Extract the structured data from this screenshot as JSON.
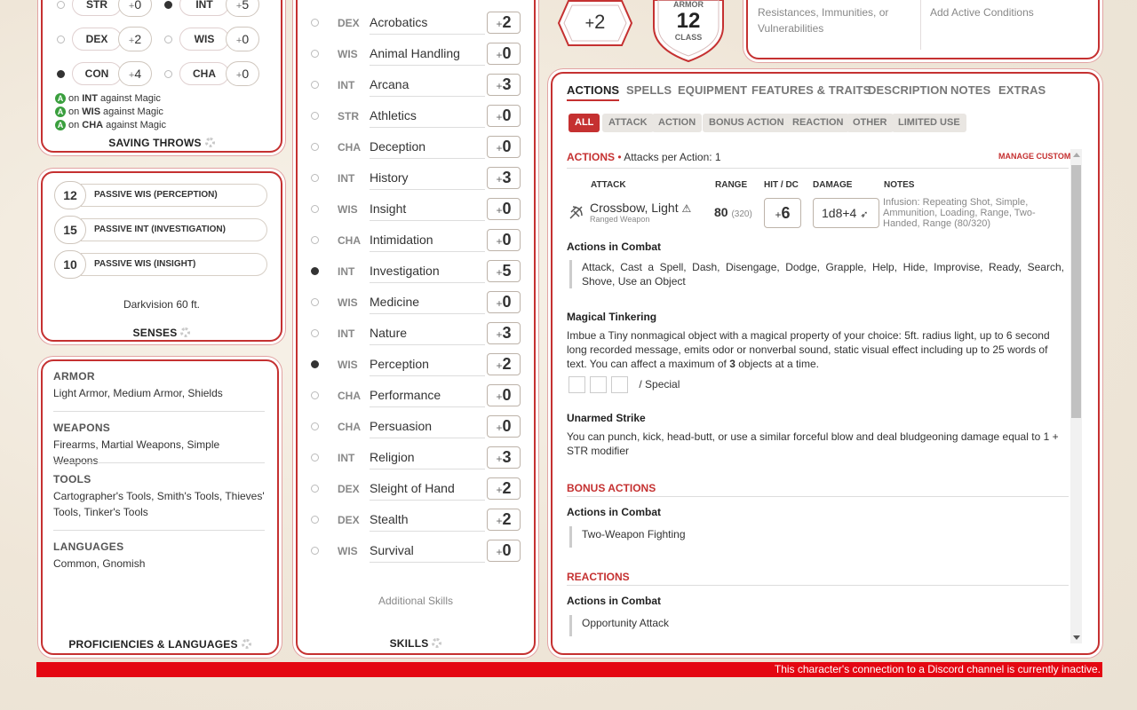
{
  "saving_throws": [
    {
      "abbr": "STR",
      "value": "0",
      "sign": "+",
      "proficient": false
    },
    {
      "abbr": "INT",
      "value": "5",
      "sign": "+",
      "proficient": true
    },
    {
      "abbr": "DEX",
      "value": "2",
      "sign": "+",
      "proficient": false
    },
    {
      "abbr": "WIS",
      "value": "0",
      "sign": "+",
      "proficient": false
    },
    {
      "abbr": "CON",
      "value": "4",
      "sign": "+",
      "proficient": true
    },
    {
      "abbr": "CHA",
      "value": "0",
      "sign": "+",
      "proficient": false
    }
  ],
  "advantages": [
    {
      "pre": "on",
      "stat": "INT",
      "post": "against Magic"
    },
    {
      "pre": "on",
      "stat": "WIS",
      "post": "against Magic"
    },
    {
      "pre": "on",
      "stat": "CHA",
      "post": "against Magic"
    }
  ],
  "saving_throws_label": "SAVING THROWS",
  "senses": [
    {
      "value": "12",
      "label": "PASSIVE WIS (PERCEPTION)"
    },
    {
      "value": "15",
      "label": "PASSIVE INT (INVESTIGATION)"
    },
    {
      "value": "10",
      "label": "PASSIVE WIS (INSIGHT)"
    }
  ],
  "darkvision": "Darkvision 60 ft.",
  "senses_label": "SENSES",
  "proficiencies": [
    {
      "title": "ARMOR",
      "text": "Light Armor, Medium Armor, Shields"
    },
    {
      "title": "WEAPONS",
      "text": "Firearms, Martial Weapons, Simple Weapons"
    },
    {
      "title": "TOOLS",
      "text": "Cartographer's Tools, Smith's Tools, Thieves' Tools, Tinker's Tools"
    },
    {
      "title": "LANGUAGES",
      "text": "Common, Gnomish"
    }
  ],
  "proficiencies_label": "PROFICIENCIES & LANGUAGES",
  "skills": [
    {
      "attr": "DEX",
      "name": "Acrobatics",
      "sign": "+",
      "bonus": "2",
      "proficient": false
    },
    {
      "attr": "WIS",
      "name": "Animal Handling",
      "sign": "+",
      "bonus": "0",
      "proficient": false
    },
    {
      "attr": "INT",
      "name": "Arcana",
      "sign": "+",
      "bonus": "3",
      "proficient": false
    },
    {
      "attr": "STR",
      "name": "Athletics",
      "sign": "+",
      "bonus": "0",
      "proficient": false
    },
    {
      "attr": "CHA",
      "name": "Deception",
      "sign": "+",
      "bonus": "0",
      "proficient": false
    },
    {
      "attr": "INT",
      "name": "History",
      "sign": "+",
      "bonus": "3",
      "proficient": false
    },
    {
      "attr": "WIS",
      "name": "Insight",
      "sign": "+",
      "bonus": "0",
      "proficient": false
    },
    {
      "attr": "CHA",
      "name": "Intimidation",
      "sign": "+",
      "bonus": "0",
      "proficient": false
    },
    {
      "attr": "INT",
      "name": "Investigation",
      "sign": "+",
      "bonus": "5",
      "proficient": true
    },
    {
      "attr": "WIS",
      "name": "Medicine",
      "sign": "+",
      "bonus": "0",
      "proficient": false
    },
    {
      "attr": "INT",
      "name": "Nature",
      "sign": "+",
      "bonus": "3",
      "proficient": false
    },
    {
      "attr": "WIS",
      "name": "Perception",
      "sign": "+",
      "bonus": "2",
      "proficient": true
    },
    {
      "attr": "CHA",
      "name": "Performance",
      "sign": "+",
      "bonus": "0",
      "proficient": false
    },
    {
      "attr": "CHA",
      "name": "Persuasion",
      "sign": "+",
      "bonus": "0",
      "proficient": false
    },
    {
      "attr": "INT",
      "name": "Religion",
      "sign": "+",
      "bonus": "3",
      "proficient": false
    },
    {
      "attr": "DEX",
      "name": "Sleight of Hand",
      "sign": "+",
      "bonus": "2",
      "proficient": false
    },
    {
      "attr": "DEX",
      "name": "Stealth",
      "sign": "+",
      "bonus": "2",
      "proficient": false
    },
    {
      "attr": "WIS",
      "name": "Survival",
      "sign": "+",
      "bonus": "0",
      "proficient": false
    }
  ],
  "additional_skills": "Additional Skills",
  "skills_label": "SKILLS",
  "proficiency_bonus": {
    "sign": "+",
    "value": "2"
  },
  "armor_class": {
    "top": "ARMOR",
    "value": "12",
    "bottom": "CLASS"
  },
  "defenses_text": "Resistances, Immunities, or Vulnerabilities",
  "conditions_text": "Add Active Conditions",
  "tabs": [
    "ACTIONS",
    "SPELLS",
    "EQUIPMENT",
    "FEATURES & TRAITS",
    "DESCRIPTION",
    "NOTES",
    "EXTRAS"
  ],
  "filters": [
    "ALL",
    "ATTACK",
    "ACTION",
    "BONUS ACTION",
    "REACTION",
    "OTHER",
    "LIMITED USE"
  ],
  "actions_header": {
    "title": "ACTIONS",
    "bullet": "•",
    "per_action": "Attacks per Action: 1",
    "manage": "MANAGE CUSTOM"
  },
  "attack_columns": [
    "ATTACK",
    "RANGE",
    "HIT / DC",
    "DAMAGE",
    "NOTES"
  ],
  "attack": {
    "name": "Crossbow, Light",
    "type": "Ranged Weapon",
    "range": "80",
    "range_long": "(320)",
    "hit_sign": "+",
    "hit": "6",
    "damage": "1d8+4",
    "notes": "Infusion: Repeating Shot, Simple, Ammunition, Loading, Range, Two-Handed, Range (80/320)"
  },
  "actions_in_combat_1": {
    "title": "Actions in Combat",
    "text": "Attack, Cast a Spell, Dash, Disengage, Dodge, Grapple, Help, Hide, Improvise, Ready, Search, Shove, Use an Object"
  },
  "magical_tinkering": {
    "title": "Magical Tinkering",
    "text_a": "Imbue a Tiny nonmagical object with a magical property of your choice: 5ft. radius light, up to 6 second long recorded message, emits odor or nonverbal sound, static visual effect including up to 25 words of text. You can affect a maximum of ",
    "count": "3",
    "text_b": " objects at a time.",
    "uses_suffix": "/ Special"
  },
  "unarmed_strike": {
    "title": "Unarmed Strike",
    "text": "You can punch, kick, head-butt, or use a similar forceful blow and deal bludgeoning damage equal to 1 + STR modifier"
  },
  "bonus_actions": {
    "title": "BONUS ACTIONS",
    "sub": "Actions in Combat",
    "item": "Two-Weapon Fighting"
  },
  "reactions": {
    "title": "REACTIONS",
    "sub": "Actions in Combat",
    "item": "Opportunity Attack"
  },
  "discord_notice": "This character's connection to a Discord channel is currently inactive.",
  "colors": {
    "accent": "#c53131",
    "advantage": "#3a9f3e"
  }
}
